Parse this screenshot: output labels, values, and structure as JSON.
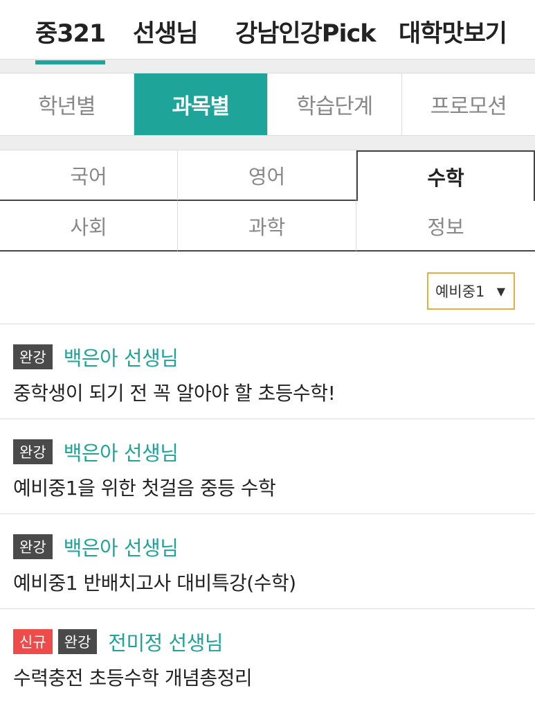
{
  "top_tabs": [
    "중321",
    "선생님",
    "강남인강Pick",
    "대학맛보기"
  ],
  "secondary_tabs": [
    "학년별",
    "과목별",
    "학습단계",
    "프로모션"
  ],
  "subjects": [
    "국어",
    "영어",
    "수학",
    "사회",
    "과학",
    "정보"
  ],
  "filter": {
    "selected": "예비중1",
    "arrow": "▼"
  },
  "colors": {
    "accent": "#1fa49a",
    "new_badge": "#ee4b4b",
    "done_badge": "#4a4a4a",
    "select_border": "#e3b03c"
  },
  "courses": [
    {
      "badges": [
        "완강"
      ],
      "teacher": "백은아 선생님",
      "title": "중학생이 되기 전 꼭 알아야 할 초등수학!"
    },
    {
      "badges": [
        "완강"
      ],
      "teacher": "백은아 선생님",
      "title": "예비중1을 위한 첫걸음 중등 수학"
    },
    {
      "badges": [
        "완강"
      ],
      "teacher": "백은아 선생님",
      "title": "예비중1 반배치고사 대비특강(수학)"
    },
    {
      "badges": [
        "신규",
        "완강"
      ],
      "teacher": "전미정 선생님",
      "title": "수력충전 초등수학 개념총정리"
    }
  ]
}
